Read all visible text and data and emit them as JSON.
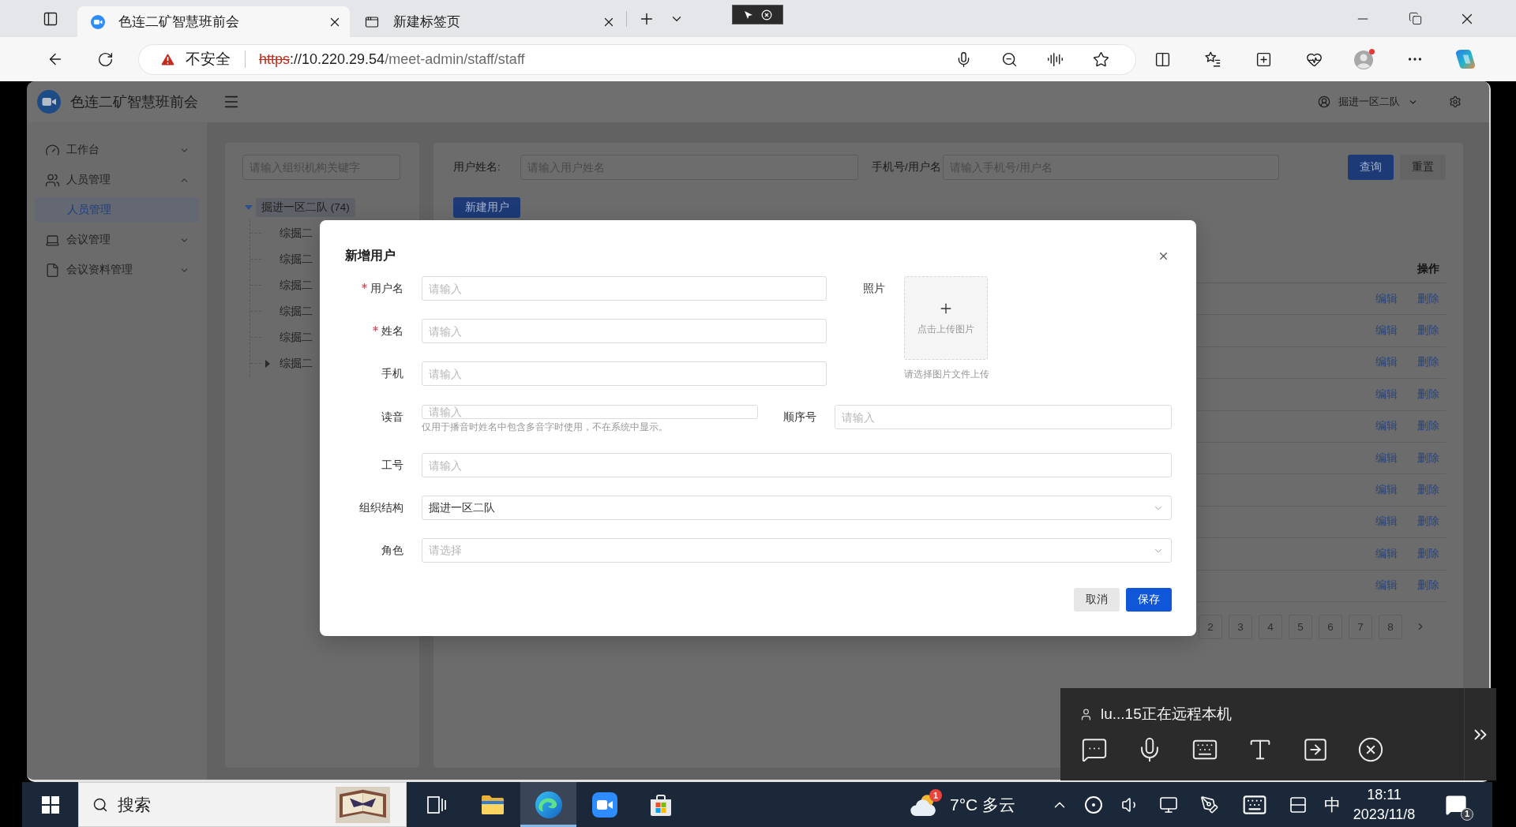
{
  "browser": {
    "tabs": [
      {
        "title": "色连二矿智慧班前会",
        "selected": true
      },
      {
        "title": "新建标签页",
        "selected": false
      }
    ],
    "address": {
      "security_label": "不安全",
      "url_scheme": "https",
      "url_host": "://10.220.29.54",
      "url_path": "/meet-admin/staff/staff"
    }
  },
  "app": {
    "title": "色连二矿智慧班前会",
    "user": "掘进一区二队"
  },
  "sidebar": {
    "items": [
      {
        "label": "工作台",
        "expanded": false
      },
      {
        "label": "人员管理",
        "expanded": true,
        "children": [
          {
            "label": "人员管理",
            "selected": true
          }
        ]
      },
      {
        "label": "会议管理",
        "expanded": false
      },
      {
        "label": "会议资料管理",
        "expanded": false
      }
    ]
  },
  "org_tree": {
    "search": {
      "placeholder": "请输入组织机构关键字"
    },
    "root": {
      "label": "掘进一区二队 (74)",
      "expanded": true,
      "selected": true,
      "children": [
        {
          "label": "综掘二",
          "kind": "leaf",
          "selected": false
        },
        {
          "label": "综掘二",
          "kind": "leaf",
          "selected": false
        },
        {
          "label": "综掘二",
          "kind": "leaf",
          "selected": false
        },
        {
          "label": "综掘二",
          "kind": "leaf",
          "selected": false
        },
        {
          "label": "综掘二",
          "kind": "leaf",
          "selected": false
        },
        {
          "label": "综掘二",
          "kind": "branch",
          "expanded": false,
          "selected": false
        }
      ]
    }
  },
  "query": {
    "fields": [
      {
        "label": "用户姓名:",
        "placeholder": "请输入用户姓名"
      },
      {
        "label": "手机号/用户名",
        "placeholder": "请输入手机号/用户名"
      }
    ],
    "buttons": [
      {
        "label": "查询",
        "kind": "primary"
      },
      {
        "label": "重置",
        "kind": "default"
      }
    ]
  },
  "actions": [
    {
      "label": "新建用户",
      "kind": "primary"
    }
  ],
  "table": {
    "columns": [
      "操作"
    ],
    "rows": [
      {
        "actions": [
          "编辑",
          "删除"
        ]
      },
      {
        "actions": [
          "编辑",
          "删除"
        ]
      },
      {
        "actions": [
          "编辑",
          "删除"
        ]
      },
      {
        "actions": [
          "编辑",
          "删除"
        ]
      },
      {
        "actions": [
          "编辑",
          "删除"
        ]
      },
      {
        "actions": [
          "编辑",
          "删除"
        ]
      },
      {
        "actions": [
          "编辑",
          "删除"
        ]
      },
      {
        "actions": [
          "编辑",
          "删除"
        ]
      },
      {
        "actions": [
          "编辑",
          "删除"
        ]
      },
      {
        "actions": [
          "编辑",
          "删除"
        ]
      }
    ]
  },
  "pagination": {
    "pages": [
      {
        "label": "2",
        "selected": false
      },
      {
        "label": "3",
        "selected": false
      },
      {
        "label": "4",
        "selected": false
      },
      {
        "label": "5",
        "selected": false
      },
      {
        "label": "6",
        "selected": false
      },
      {
        "label": "7",
        "selected": false
      },
      {
        "label": "8",
        "selected": false
      }
    ]
  },
  "dialog": {
    "title": "新增用户",
    "fields": [
      {
        "label": "用户名",
        "required": true,
        "placeholder": "请输入"
      },
      {
        "label": "姓名",
        "required": true,
        "placeholder": "请输入"
      },
      {
        "label": "手机",
        "required": false,
        "placeholder": "请输入"
      }
    ],
    "photo": {
      "label": "照片",
      "button": "点击上传图片",
      "hint": "请选择图片文件上传"
    },
    "pronunciation": {
      "label": "读音",
      "required": false,
      "placeholder": "请输入",
      "hint": "仅用于播音时姓名中包含多音字时使用，不在系统中显示。"
    },
    "order_number": {
      "label": "顺序号",
      "required": false,
      "placeholder": "请输入"
    },
    "rows": [
      {
        "label": "工号",
        "required": false,
        "kind": "input",
        "placeholder": "请输入"
      },
      {
        "label": "组织结构",
        "required": false,
        "kind": "select",
        "value": "掘进一区二队"
      },
      {
        "label": "角色",
        "required": false,
        "kind": "select",
        "placeholder": "请选择"
      }
    ],
    "buttons": [
      {
        "label": "取消",
        "kind": "default"
      },
      {
        "label": "保存",
        "kind": "primary"
      }
    ]
  },
  "remote_panel": {
    "status": "lu...15正在远程本机"
  },
  "taskbar": {
    "search": {
      "placeholder": "搜索"
    },
    "apps": [
      {
        "active": false
      },
      {
        "active": false
      },
      {
        "active": true
      },
      {
        "active": false
      },
      {
        "active": false
      }
    ],
    "weather": {
      "text": "7°C 多云",
      "badge": "1"
    },
    "ime": "中",
    "clock": {
      "time": "18:11",
      "date": "2023/11/8"
    },
    "notification_badge": "1"
  }
}
